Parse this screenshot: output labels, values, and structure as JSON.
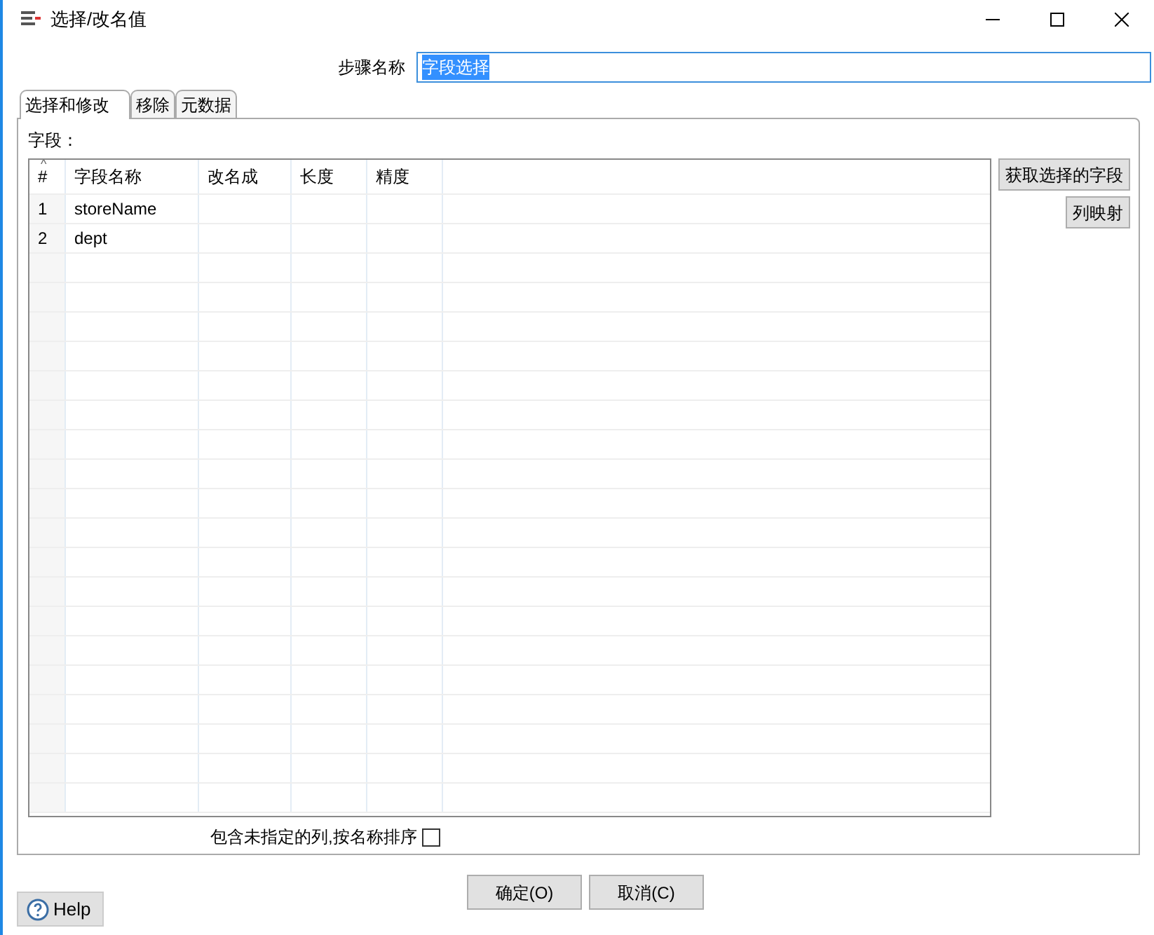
{
  "window": {
    "title": "选择/改名值"
  },
  "step_name": {
    "label": "步骤名称",
    "value": "字段选择",
    "highlighted": true
  },
  "tabs": [
    {
      "label": "选择和修改",
      "selected": true
    },
    {
      "label": "移除",
      "selected": false
    },
    {
      "label": "元数据",
      "selected": false
    }
  ],
  "fields_label": "字段：",
  "table": {
    "sort_mark": "^",
    "columns": [
      "#",
      "字段名称",
      "改名成",
      "长度",
      "精度"
    ],
    "rows": [
      [
        "1",
        "storeName",
        "",
        "",
        ""
      ],
      [
        "2",
        "dept",
        "",
        "",
        ""
      ]
    ]
  },
  "side_buttons": [
    "获取选择的字段",
    "列映射"
  ],
  "include_unspecified": {
    "label": "包含未指定的列,按名称排序",
    "checked": false
  },
  "help_button": "Help",
  "buttons": [
    "确定(O)",
    "取消(C)"
  ]
}
